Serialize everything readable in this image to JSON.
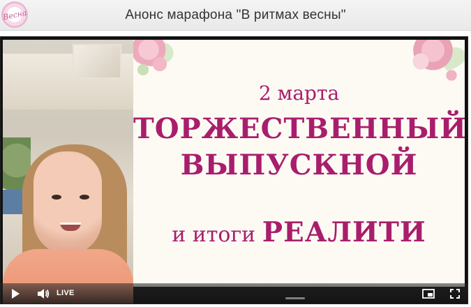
{
  "header": {
    "title": "Анонс марафона \"В ритмах весны\"",
    "logo_text": "Весна"
  },
  "slide": {
    "line1": "2 марта",
    "line2": "ТОРЖЕСТВЕННЫЙ",
    "line3": "ВЫПУСКНОЙ",
    "line4_prefix": "и итоги ",
    "line4_bold": "РЕАЛИТИ"
  },
  "player": {
    "live_label": "LIVE",
    "icons": [
      "play-icon",
      "volume-icon",
      "picture-in-picture-icon",
      "fullscreen-icon"
    ]
  },
  "colors": {
    "slide_text": "#a81e6c",
    "slide_bg": "#fdfaf4",
    "header_bg": "#efefef"
  }
}
